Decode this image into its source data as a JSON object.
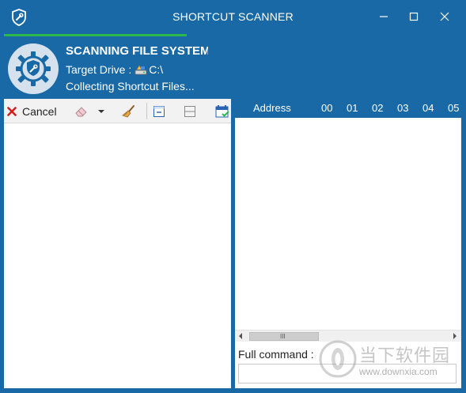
{
  "window": {
    "title": "SHORTCUT SCANNER",
    "app_icon": "shield-wrench-icon",
    "controls": [
      "minimize-icon",
      "maximize-icon",
      "close-icon"
    ],
    "accent_color": "#1869a6"
  },
  "status": {
    "title": "SCANNING FILE SYSTEM",
    "drive_label": "Target Drive :",
    "drive_icon": "drive-icon",
    "drive_value": "C:\\",
    "detail": "Collecting Shortcut Files...",
    "progress_color": "#2db84a",
    "icon": "gear-shield-icon"
  },
  "toolbar": {
    "cancel_label": "Cancel",
    "cancel_icon": "x-icon",
    "erase_icon": "eraser-icon",
    "dropdown_icon": "caret-down-icon",
    "clean_icon": "broom-icon",
    "view1_icon": "panel-view-icon",
    "view2_icon": "split-view-icon",
    "calendar_icon": "calendar-check-icon"
  },
  "hex": {
    "address_label": "Address",
    "columns": [
      "00",
      "01",
      "02",
      "03",
      "04",
      "05"
    ],
    "scroll_grip": "III"
  },
  "command": {
    "label": "Full command :",
    "value": ""
  },
  "watermark": {
    "brand_text": "当下软件园",
    "url": "www.downxia.com"
  }
}
